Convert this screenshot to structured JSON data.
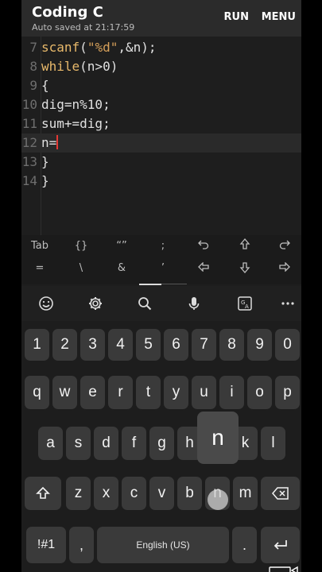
{
  "app": {
    "title": "Coding C",
    "subtitle": "Auto saved at 21:17:59",
    "run_label": "RUN",
    "menu_label": "MENU"
  },
  "editor": {
    "lines": [
      {
        "num": "7",
        "code": "scanf(\"%d\",&n);"
      },
      {
        "num": "8",
        "code": "while(n>0)"
      },
      {
        "num": "9",
        "code": "{"
      },
      {
        "num": "10",
        "code": "dig=n%10;"
      },
      {
        "num": "11",
        "code": "sum+=dig;"
      },
      {
        "num": "12",
        "code": "n="
      },
      {
        "num": "13",
        "code": "}"
      },
      {
        "num": "14",
        "code": "}"
      }
    ],
    "active_line": "12"
  },
  "symbol_bar": {
    "row1": [
      "Tab",
      "{}",
      "“”",
      ";",
      "undo-icon",
      "arrow-up-icon",
      "redo-icon"
    ],
    "row2": [
      "=",
      "\\",
      "&",
      "’",
      "arrow-left-icon",
      "arrow-down-icon",
      "arrow-right-icon"
    ],
    "tab": "Tab",
    "braces": "{}",
    "quotes": "“”",
    "semicolon": ";",
    "equals": "=",
    "backslash": "\\",
    "ampersand": "&",
    "apostrophe": "’"
  },
  "keyboard": {
    "toolbar": [
      "emoji-icon",
      "settings-icon",
      "search-icon",
      "microphone-icon",
      "translate-icon",
      "more-icon"
    ],
    "numbers": [
      "1",
      "2",
      "3",
      "4",
      "5",
      "6",
      "7",
      "8",
      "9",
      "0"
    ],
    "row1": [
      "q",
      "w",
      "e",
      "r",
      "t",
      "y",
      "u",
      "i",
      "o",
      "p"
    ],
    "row2": [
      "a",
      "s",
      "d",
      "f",
      "g",
      "h",
      "j",
      "k",
      "l"
    ],
    "row3": [
      "z",
      "x",
      "c",
      "v",
      "b",
      "n",
      "m"
    ],
    "symbols_key": "!#1",
    "comma": ",",
    "space_label": "English (US)",
    "period": ".",
    "popup_letter": "n"
  },
  "colors": {
    "background": "#1e1e1e",
    "appbar": "#2b2b2b",
    "key": "#3a3a3a",
    "keyword": "#e8b96b",
    "cursor": "#e53935"
  }
}
